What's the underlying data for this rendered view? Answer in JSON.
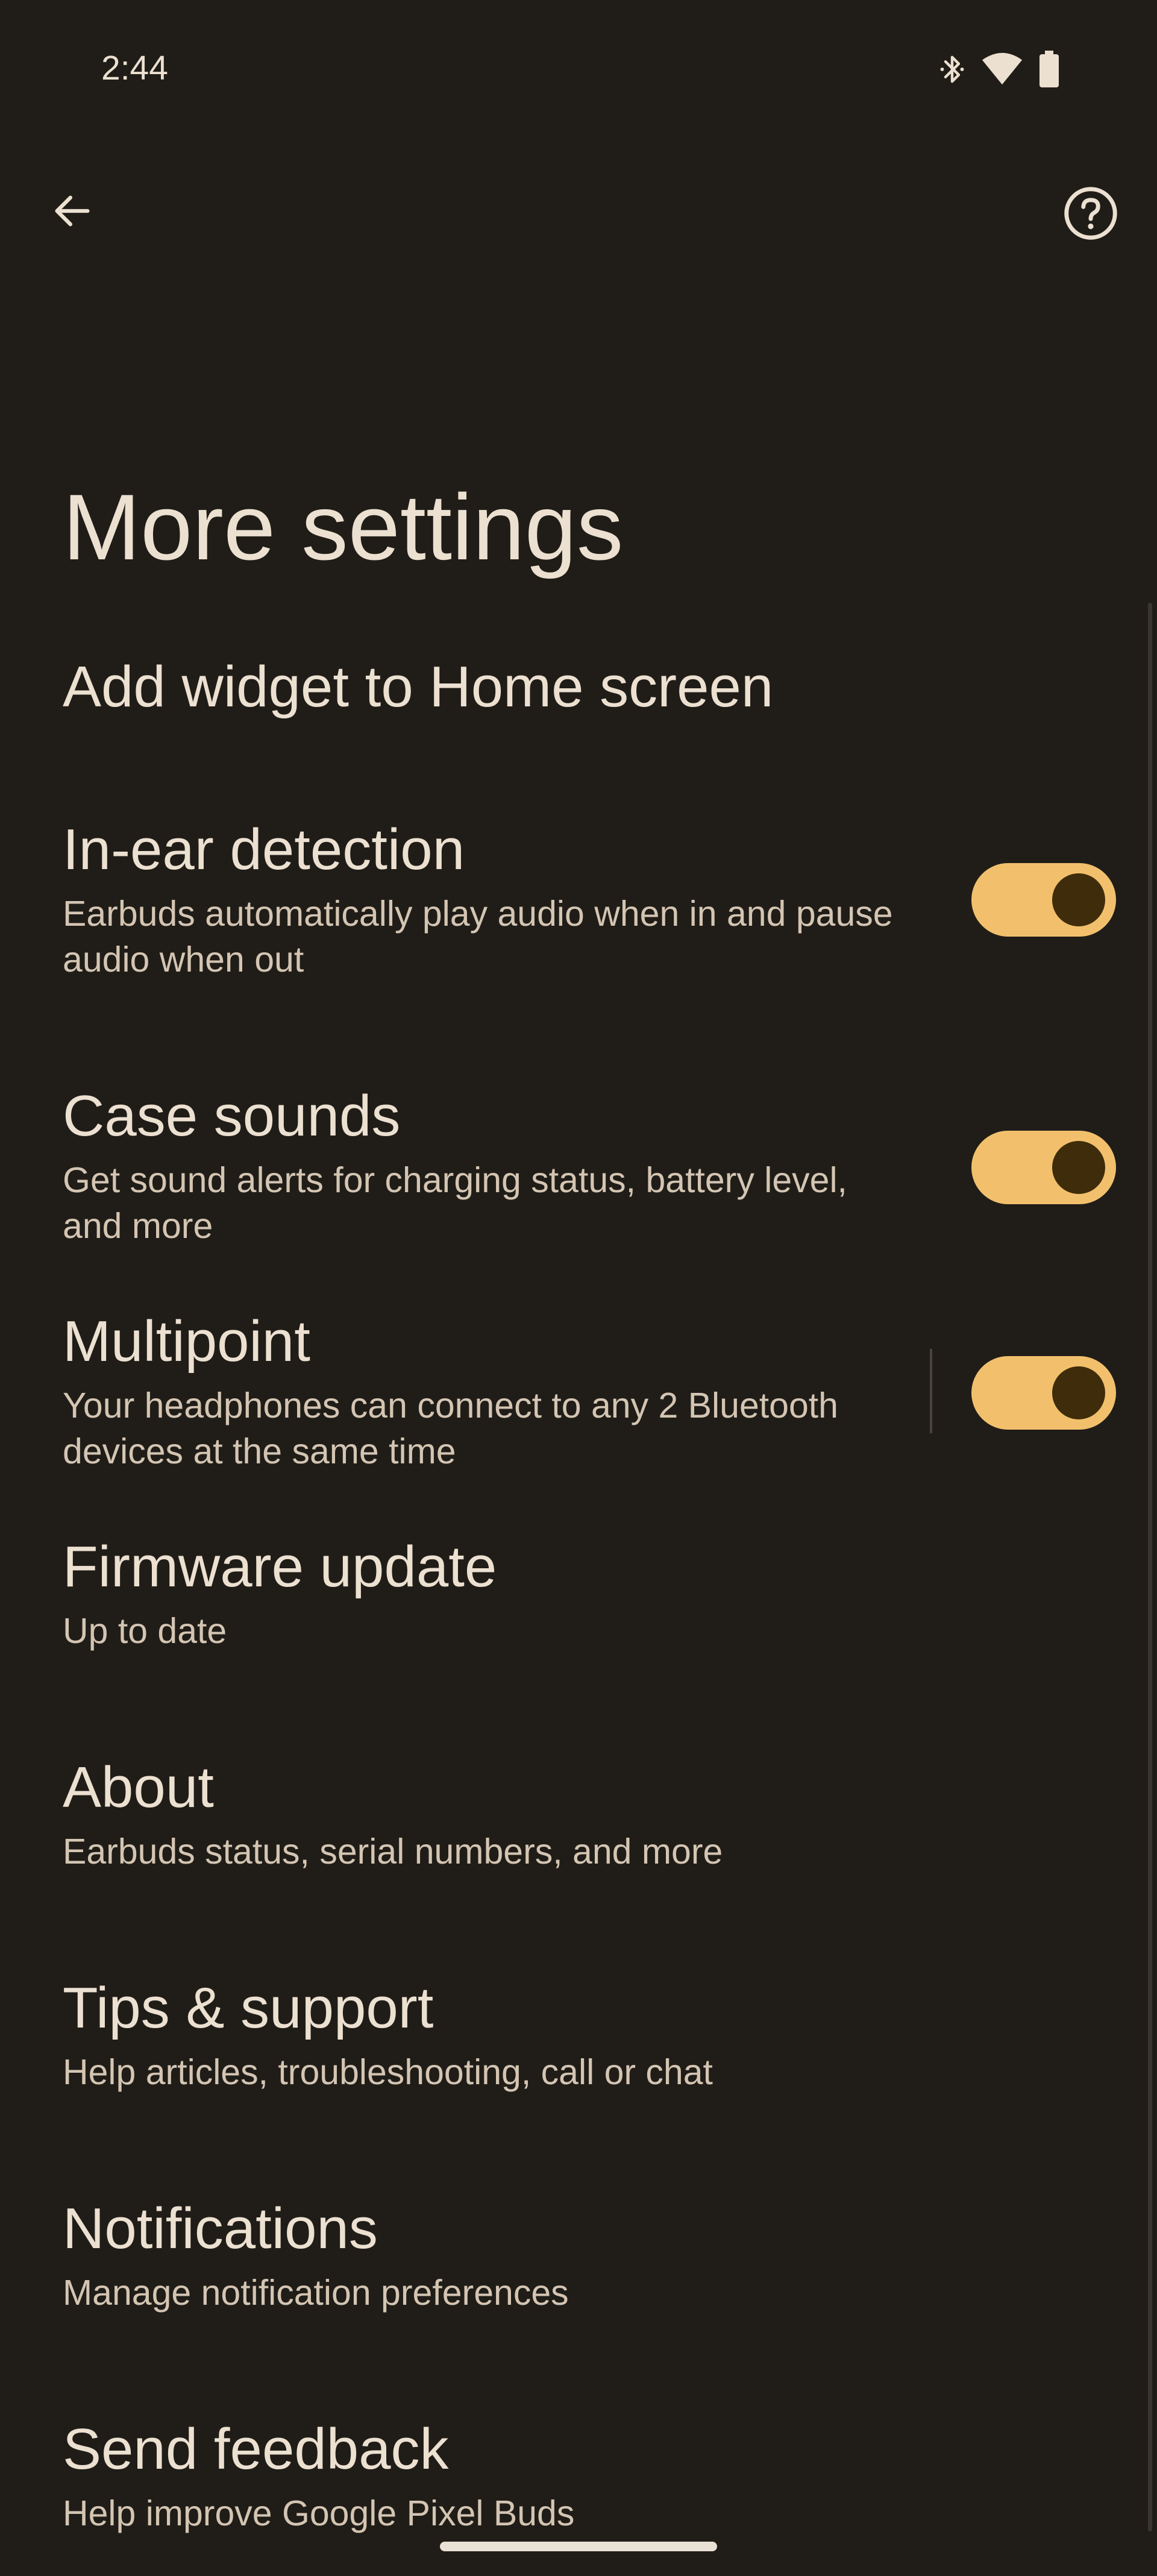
{
  "status_bar": {
    "time": "2:44",
    "icons": [
      "bluetooth-icon",
      "wifi-icon",
      "battery-icon"
    ]
  },
  "app_bar": {
    "back_icon": "arrow-back-icon",
    "help_icon": "help-circle-icon"
  },
  "page": {
    "title": "More settings"
  },
  "settings": {
    "add_widget": {
      "title": "Add widget to Home screen"
    },
    "in_ear_detection": {
      "title": "In-ear detection",
      "subtitle": "Earbuds automatically play audio when in and pause audio when out",
      "enabled": true
    },
    "case_sounds": {
      "title": "Case sounds",
      "subtitle": "Get sound alerts for charging status, battery level, and more",
      "enabled": true
    },
    "multipoint": {
      "title": "Multipoint",
      "subtitle": "Your headphones can connect to any 2 Bluetooth devices at the same time",
      "enabled": true
    },
    "firmware_update": {
      "title": "Firmware update",
      "subtitle": "Up to date"
    },
    "about": {
      "title": "About",
      "subtitle": "Earbuds status, serial numbers, and more"
    },
    "tips_support": {
      "title": "Tips & support",
      "subtitle": "Help articles, troubleshooting, call or chat"
    },
    "notifications": {
      "title": "Notifications",
      "subtitle": "Manage notification preferences"
    },
    "send_feedback": {
      "title": "Send feedback",
      "subtitle": "Help improve Google Pixel Buds"
    }
  },
  "colors": {
    "background": "#201d18",
    "text_primary": "#ece0d1",
    "text_secondary": "#d4c5b3",
    "switch_track_on": "#f2c06c",
    "switch_thumb_on": "#3f2c0b"
  }
}
